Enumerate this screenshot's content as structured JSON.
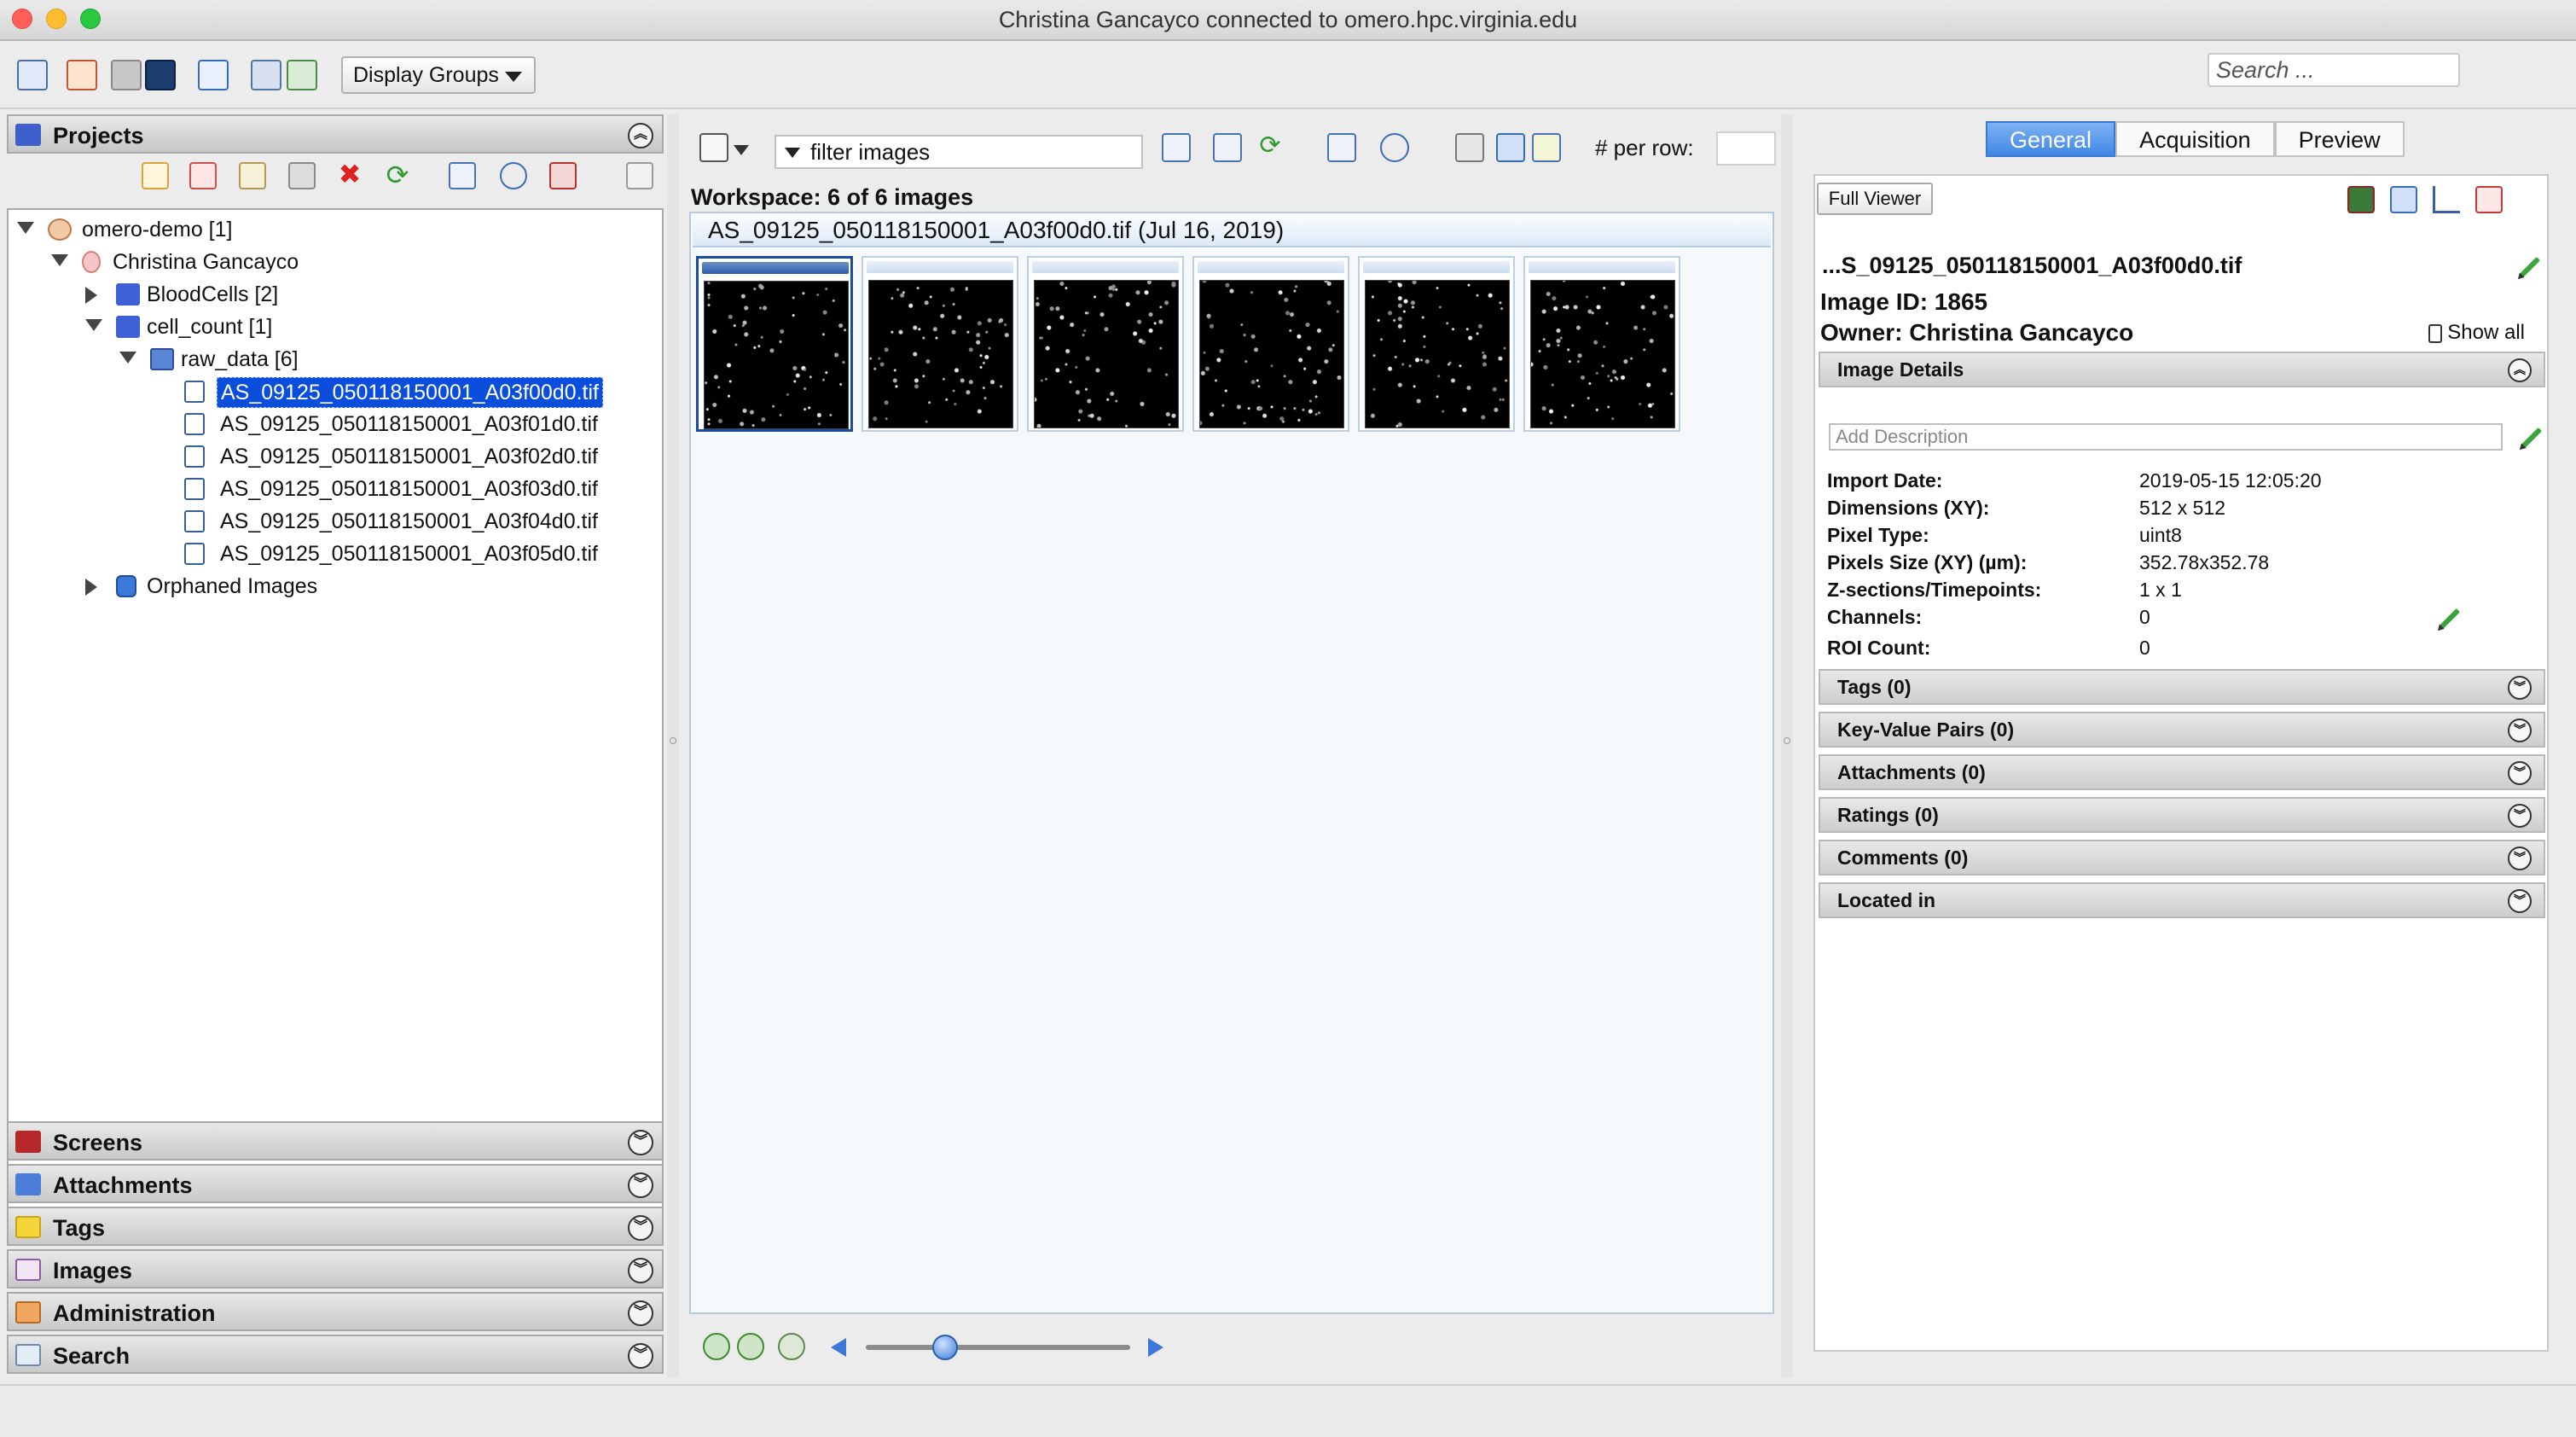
{
  "window": {
    "title": "Christina Gancayco connected to omero.hpc.virginia.edu"
  },
  "toolbar": {
    "display_groups_label": "Display Groups",
    "search_placeholder": "Search ..."
  },
  "left": {
    "projects_title": "Projects",
    "tree": [
      {
        "label": "omero-demo [1]"
      },
      {
        "label": "Christina Gancayco"
      },
      {
        "label": "BloodCells [2]"
      },
      {
        "label": "cell_count [1]"
      },
      {
        "label": "raw_data [6]"
      },
      {
        "label": "AS_09125_050118150001_A03f00d0.tif"
      },
      {
        "label": "AS_09125_050118150001_A03f01d0.tif"
      },
      {
        "label": "AS_09125_050118150001_A03f02d0.tif"
      },
      {
        "label": "AS_09125_050118150001_A03f03d0.tif"
      },
      {
        "label": "AS_09125_050118150001_A03f04d0.tif"
      },
      {
        "label": "AS_09125_050118150001_A03f05d0.tif"
      },
      {
        "label": "Orphaned Images"
      }
    ],
    "bottom_panels": [
      {
        "label": "Screens"
      },
      {
        "label": "Attachments"
      },
      {
        "label": "Tags"
      },
      {
        "label": "Images"
      },
      {
        "label": "Administration"
      },
      {
        "label": "Search"
      }
    ]
  },
  "center": {
    "filter_text": "filter  images",
    "per_row_label": "# per row:",
    "workspace_label": "Workspace: 6 of 6 images",
    "browser_title": "AS_09125_050118150001_A03f00d0.tif (Jul 16, 2019)",
    "thumbnail_count": 6,
    "zoom_slider_fraction": 0.3
  },
  "right": {
    "tabs": [
      {
        "label": "General"
      },
      {
        "label": "Acquisition"
      },
      {
        "label": "Preview"
      }
    ],
    "full_viewer_label": "Full Viewer",
    "image_name": "...S_09125_050118150001_A03f00d0.tif",
    "image_id": "Image ID: 1865",
    "owner": "Owner: Christina Gancayco",
    "show_all": "Show all",
    "image_details_title": "Image Details",
    "description_placeholder": "Add Description",
    "details": [
      {
        "key": "Import Date:",
        "value": "2019-05-15 12:05:20"
      },
      {
        "key": "Dimensions (XY):",
        "value": "512 x 512"
      },
      {
        "key": "Pixel Type:",
        "value": "uint8"
      },
      {
        "key": "Pixels Size (XY) (µm):",
        "value": "352.78x352.78"
      },
      {
        "key": "Z-sections/Timepoints:",
        "value": "1 x 1"
      },
      {
        "key": "Channels:",
        "value": "0"
      },
      {
        "key": "ROI Count:",
        "value": "0"
      }
    ],
    "sections": [
      {
        "label": "Tags (0)"
      },
      {
        "label": "Key-Value Pairs (0)"
      },
      {
        "label": "Attachments (0)"
      },
      {
        "label": "Ratings (0)"
      },
      {
        "label": "Comments (0)"
      },
      {
        "label": "Located in"
      }
    ]
  },
  "colors": {
    "selection": "#0b4edc",
    "tab_active": "#3f86e6",
    "thumb_selected": "#1d4b9c"
  }
}
